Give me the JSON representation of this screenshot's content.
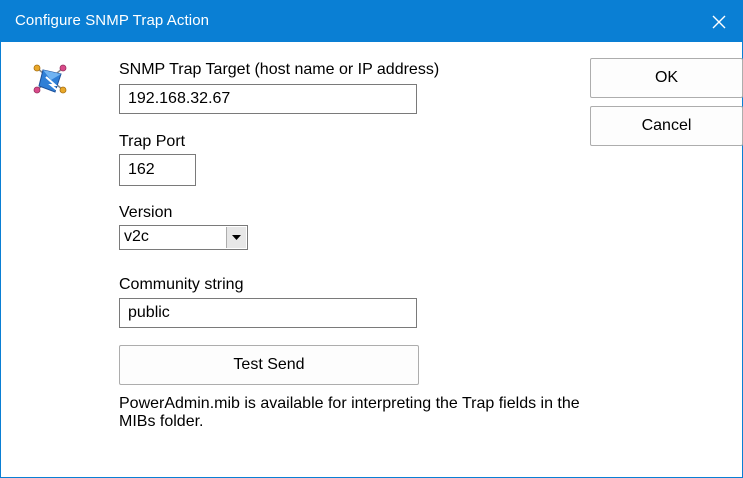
{
  "window": {
    "title": "Configure SNMP Trap Action"
  },
  "form": {
    "target_label": "SNMP Trap Target (host name or IP address)",
    "target_value": "192.168.32.67",
    "port_label": "Trap Port",
    "port_value": "162",
    "version_label": "Version",
    "version_value": "v2c",
    "community_label": "Community string",
    "community_value": "public",
    "test_send_label": "Test Send",
    "info_text": "PowerAdmin.mib is available for interpreting the Trap fields in the MIBs folder."
  },
  "buttons": {
    "ok_label": "OK",
    "cancel_label": "Cancel"
  },
  "icons": {
    "close": "close-icon",
    "app": "snmp-network-icon",
    "dropdown": "dropdown-arrow-icon"
  },
  "colors": {
    "titlebar": "#0a7fd4",
    "title_text": "#ffffff"
  }
}
